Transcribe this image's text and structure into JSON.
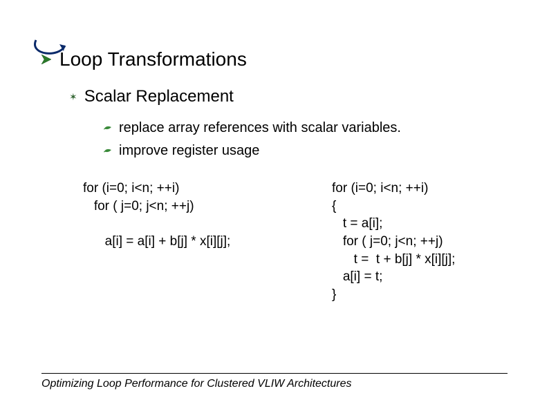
{
  "heading": "Loop Transformations",
  "subheading": "Scalar Replacement",
  "bullets": [
    "replace array references with scalar variables.",
    "improve register usage"
  ],
  "code_left": "for (i=0; i<n; ++i)\n   for ( j=0; j<n; ++j)\n\n      a[i] = a[i] + b[j] * x[i][j];",
  "code_right": "for (i=0; i<n; ++i)\n{\n   t = a[i];\n   for ( j=0; j<n; ++j)\n      t =  t + b[j] * x[i][j];\n   a[i] = t;\n}",
  "footer": "Optimizing Loop Performance for Clustered VLIW Architectures"
}
